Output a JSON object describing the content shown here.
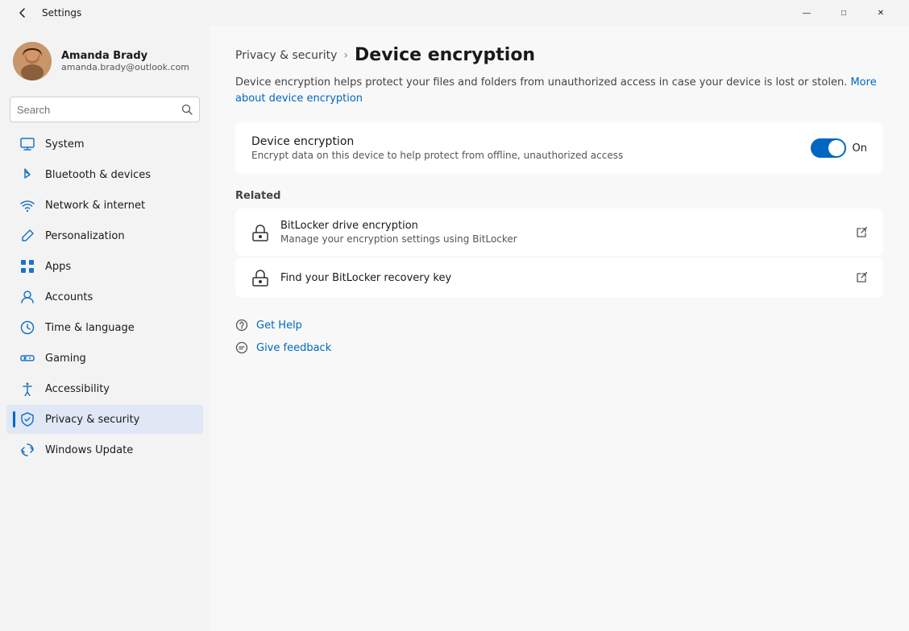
{
  "window": {
    "title": "Settings",
    "controls": {
      "minimize": "—",
      "maximize": "□",
      "close": "✕"
    }
  },
  "user": {
    "name": "Amanda Brady",
    "email": "amanda.brady@outlook.com"
  },
  "search": {
    "placeholder": "Search"
  },
  "nav": [
    {
      "id": "system",
      "label": "System",
      "icon": "system"
    },
    {
      "id": "bluetooth",
      "label": "Bluetooth & devices",
      "icon": "bluetooth"
    },
    {
      "id": "network",
      "label": "Network & internet",
      "icon": "network"
    },
    {
      "id": "personalization",
      "label": "Personalization",
      "icon": "pen"
    },
    {
      "id": "apps",
      "label": "Apps",
      "icon": "apps"
    },
    {
      "id": "accounts",
      "label": "Accounts",
      "icon": "accounts"
    },
    {
      "id": "time",
      "label": "Time & language",
      "icon": "time"
    },
    {
      "id": "gaming",
      "label": "Gaming",
      "icon": "gaming"
    },
    {
      "id": "accessibility",
      "label": "Accessibility",
      "icon": "accessibility"
    },
    {
      "id": "privacy",
      "label": "Privacy & security",
      "icon": "shield",
      "active": true
    },
    {
      "id": "update",
      "label": "Windows Update",
      "icon": "update"
    }
  ],
  "breadcrumb": {
    "parent": "Privacy & security",
    "current": "Device encryption"
  },
  "description": {
    "text": "Device encryption helps protect your files and folders from unauthorized access in case your device is lost or stolen.",
    "link_text": "More about device encryption",
    "link_url": "#"
  },
  "device_encryption": {
    "title": "Device encryption",
    "description": "Encrypt data on this device to help protect from offline, unauthorized access",
    "toggle_state": "On",
    "toggle_enabled": true
  },
  "related": {
    "label": "Related",
    "items": [
      {
        "title": "BitLocker drive encryption",
        "description": "Manage your encryption settings using BitLocker",
        "icon": "bitlocker",
        "external": true
      },
      {
        "title": "Find your BitLocker recovery key",
        "icon": "recovery",
        "external": true
      }
    ]
  },
  "help": {
    "get_help": "Get Help",
    "give_feedback": "Give feedback"
  },
  "colors": {
    "accent": "#0067c0",
    "active_nav_bg": "#dce8f8"
  }
}
